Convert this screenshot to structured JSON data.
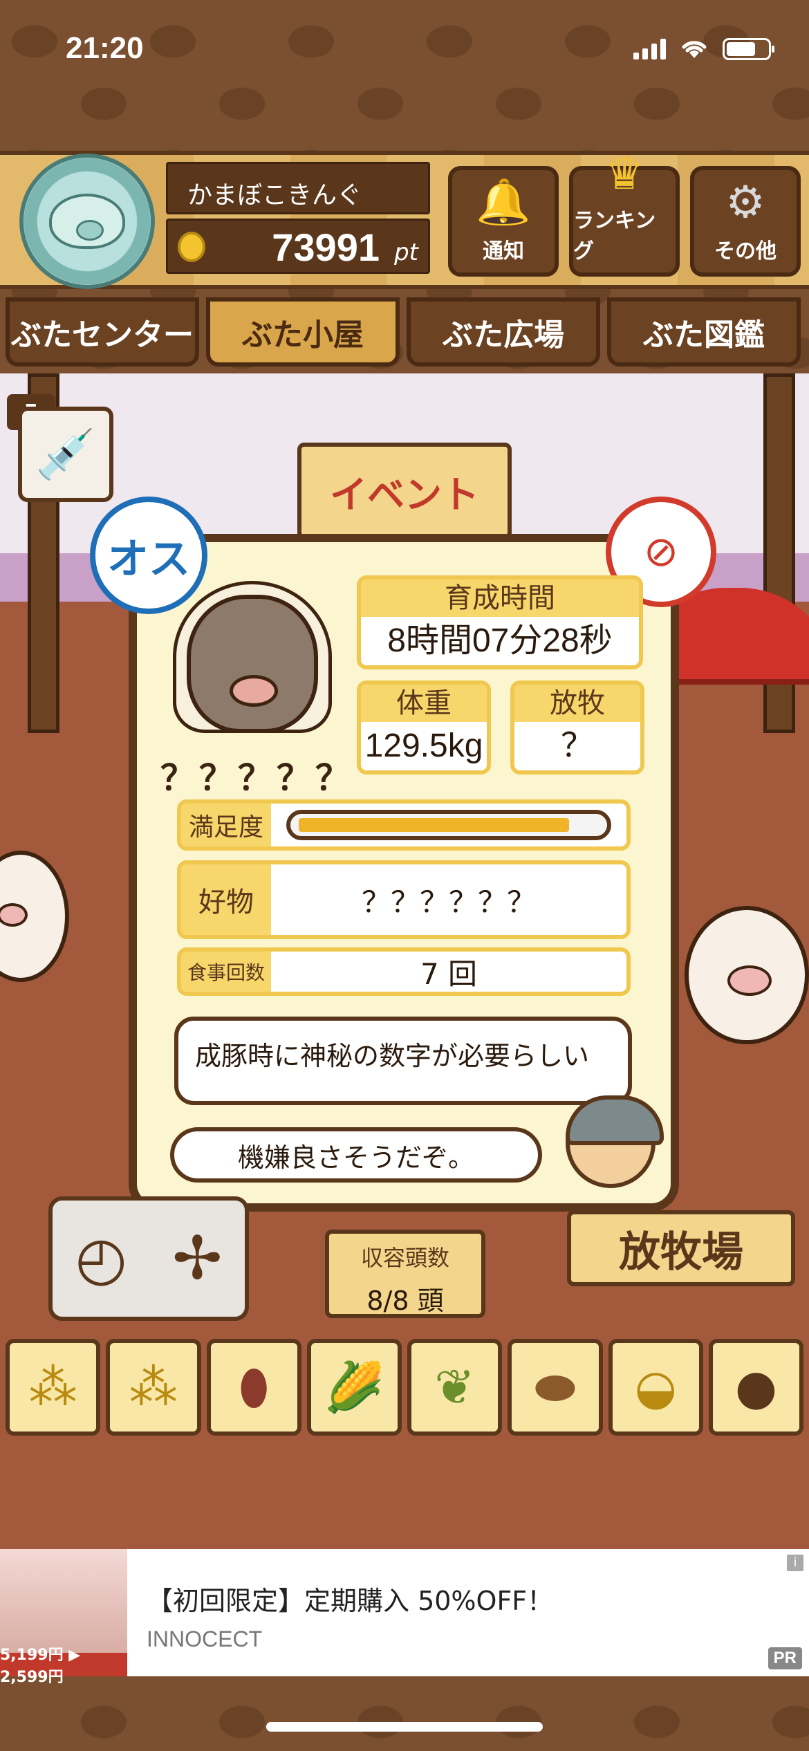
{
  "status_bar": {
    "time": "21:20"
  },
  "header": {
    "player_name": "かまぼこきんぐ",
    "points": "73991",
    "points_unit": "pt",
    "buttons": [
      {
        "label": "通知",
        "icon": "bell-icon"
      },
      {
        "label": "ランキング",
        "icon": "crown-icon"
      },
      {
        "label": "その他",
        "icon": "gear-icon"
      }
    ]
  },
  "nav_tabs": [
    {
      "label": "ぶたセンター",
      "active": false
    },
    {
      "label": "ぶた小屋",
      "active": true
    },
    {
      "label": "ぶた広場",
      "active": false
    },
    {
      "label": "ぶた図鑑",
      "active": false
    }
  ],
  "scene": {
    "event_sign": "イベント",
    "syringe_count": "5"
  },
  "pig_card": {
    "gender_badge": "オス",
    "pig_name": "？？？？？",
    "growth_time_label": "育成時間",
    "growth_time_value": "8時間07分28秒",
    "weight_label": "体重",
    "weight_value": "129.5kg",
    "grazing_label": "放牧",
    "grazing_value": "？",
    "satisfaction_label": "満足度",
    "satisfaction_level": 0.9,
    "favorite_label": "好物",
    "favorite_value": "？？？？？？",
    "meals_label": "食事回数",
    "meals_value": "7 回",
    "hint_text": "成豚時に神秘の数字が必要らしい",
    "comment_text": "機嫌良さそうだぞ。"
  },
  "bottom": {
    "capacity_label": "収容頭数",
    "capacity_value": "8/8 頭",
    "pasture_sign": "放牧場",
    "feed_items": [
      "grain-icon",
      "grain-icon",
      "sweet-potato-icon",
      "corn-icon",
      "bean-icon",
      "acorn-icon",
      "soybean-bowl-icon",
      "chestnut-plate-icon"
    ]
  },
  "ad": {
    "title": "【初回限定】定期購入 50%OFF！",
    "source": "INNOCECT",
    "badge": "PR",
    "price_text": "5,199円 ▶ 2,599円"
  }
}
